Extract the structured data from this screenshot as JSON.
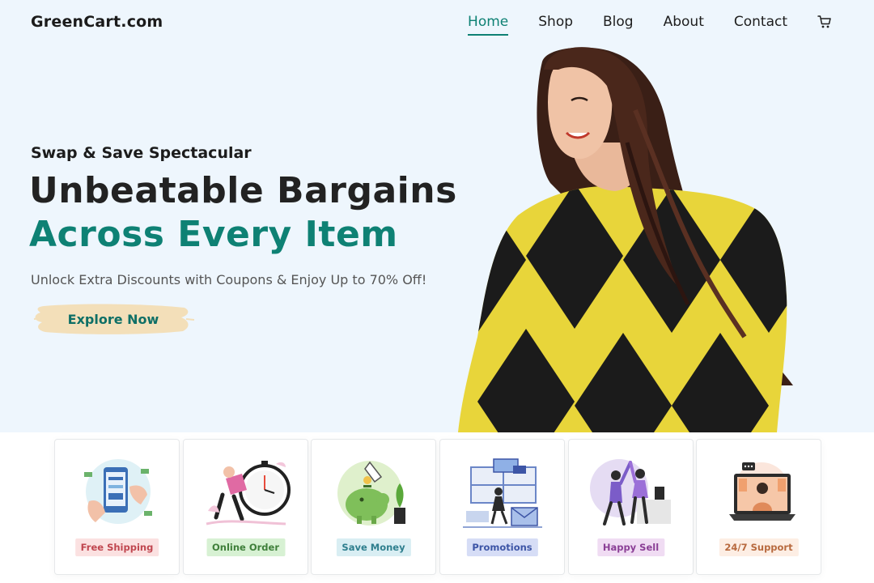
{
  "nav": {
    "logo": "GreenCart.com",
    "items": [
      {
        "label": "Home",
        "active": true
      },
      {
        "label": "Shop"
      },
      {
        "label": "Blog"
      },
      {
        "label": "About"
      },
      {
        "label": "Contact"
      }
    ],
    "cart_icon": "shopping-cart-icon"
  },
  "hero": {
    "eyebrow": "Swap & Save Spectacular",
    "headline_line1": "Unbeatable Bargains",
    "headline_line2": "Across Every Item",
    "subtext": "Unlock Extra Discounts with Coupons & Enjoy Up to 70% Off!",
    "cta_label": "Explore Now"
  },
  "features": [
    {
      "label": "Free Shipping",
      "badge_bg": "#fbe1e1",
      "badge_color": "#c0464f"
    },
    {
      "label": "Online Order",
      "badge_bg": "#d7f1d3",
      "badge_color": "#3f7f3a"
    },
    {
      "label": "Save Money",
      "badge_bg": "#d9eef3",
      "badge_color": "#2f7f8e"
    },
    {
      "label": "Promotions",
      "badge_bg": "#d6ddf6",
      "badge_color": "#3d55a6"
    },
    {
      "label": "Happy Sell",
      "badge_bg": "#f0dcf3",
      "badge_color": "#8b3f96"
    },
    {
      "label": "24/7 Support",
      "badge_bg": "#fdeee4",
      "badge_color": "#b86a3f"
    }
  ],
  "colors": {
    "accent": "#0e8174",
    "hero_bg": "#eef6fd",
    "cta_brush": "#f3dfb9",
    "sweater_yellow": "#e8d53a",
    "sweater_black": "#1b1b1b"
  }
}
